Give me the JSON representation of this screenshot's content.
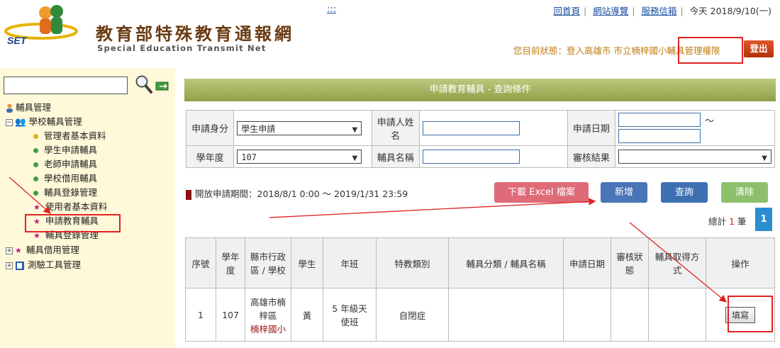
{
  "header": {
    "title": "教育部特殊教育通報網",
    "subtitle": "Special Education Transmit Net",
    "logo_text": "SET",
    "skip_link": ":::",
    "links": [
      "回首頁",
      "網站導覽",
      "服務信箱"
    ],
    "today": "今天 2018/9/10(一)",
    "status_prefix": "您目前狀態：登入高雄市 市立楠梓國小",
    "status_role": "輔具管理權限",
    "logout": "登出"
  },
  "sidebar": {
    "search_placeholder": "",
    "items": {
      "root": "輔具管理",
      "school_mgmt": "學校輔具管理",
      "admin_info": "管理者基本資料",
      "student_apply": "學生申請輔具",
      "teacher_apply": "老師申請輔具",
      "school_borrow": "學校借用輔具",
      "registration": "輔具登錄管理",
      "user_info": "使用者基本資料",
      "apply_edu": "申請教育輔具",
      "registration2": "輔具登錄管理",
      "borrow_mgmt": "輔具借用管理",
      "test_tools": "測驗工具管理"
    }
  },
  "banner": "申請教育輔具 - 查詢條件",
  "form": {
    "identity_label": "申請身分",
    "identity_value": "學生申請",
    "applicant_label": "申請人姓名",
    "date_label": "申請日期",
    "tilde": "～",
    "year_label": "學年度",
    "year_value": "107",
    "device_label": "輔具名稱",
    "result_label": "審核結果",
    "result_value": ""
  },
  "period": "開放申請期間：2018/8/1 0:00 ～ 2019/1/31 23:59",
  "buttons": {
    "excel": "下載 Excel 檔案",
    "add": "新增",
    "query": "查詢",
    "clear": "清除"
  },
  "total": {
    "prefix": "總計 ",
    "count": "1",
    "suffix": " 筆",
    "page": "1"
  },
  "table": {
    "headers": [
      "序號",
      "學年度",
      "縣市行政區 / 學校",
      "學生",
      "年班",
      "特教類別",
      "輔具分類 / 輔具名稱",
      "申請日期",
      "審核狀態",
      "輔具取得方式",
      "操作"
    ],
    "rows": [
      {
        "idx": "1",
        "year": "107",
        "region": "高雄市楠梓區",
        "school": "楠梓國小",
        "student": "黃",
        "class": "5 年級天使班",
        "category": "自閉症",
        "device": "",
        "date": "",
        "status": "",
        "method": "",
        "action": "填寫"
      }
    ]
  },
  "colors": {
    "banner": "#a3b25c",
    "brand": "#6a3b12",
    "highlight": "#e02222"
  }
}
